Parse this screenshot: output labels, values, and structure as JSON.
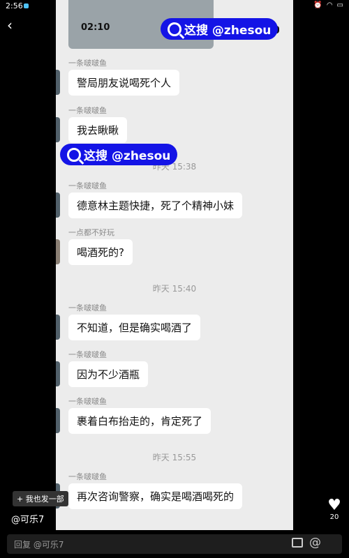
{
  "status": {
    "time": "2:56",
    "battery": "36",
    "screenshot_time": "02:10"
  },
  "watermark": {
    "text": "这搜 @zhesou"
  },
  "messages": [
    {
      "sender": "一条啵啵鱼",
      "text": "警局朋友说喝死个人"
    },
    {
      "sender": "一条啵啵鱼",
      "text": "我去瞅瞅"
    },
    {
      "sender": "一条啵啵鱼",
      "text": "德意林主题快捷，死了个精神小妹"
    },
    {
      "sender": "一点都不好玩",
      "text": "喝酒死的?"
    },
    {
      "sender": "一条啵啵鱼",
      "text": "不知道，但是确实喝酒了"
    },
    {
      "sender": "一条啵啵鱼",
      "text": "因为不少酒瓶"
    },
    {
      "sender": "一条啵啵鱼",
      "text": "裹着白布抬走的，肯定死了"
    },
    {
      "sender": "一条啵啵鱼",
      "text": "再次咨询警察，确实是喝酒喝死的"
    }
  ],
  "timestamps": [
    "昨天 15:38",
    "昨天 15:40",
    "昨天 15:55"
  ],
  "footer": {
    "side_tag": "+ 我也发一部",
    "author": "@可乐7",
    "like_count": "20",
    "reply_placeholder": "回复 @可乐7"
  },
  "icons": {
    "back": "chevron-left-icon",
    "like": "heart-icon",
    "image": "image-icon",
    "at": "at-icon"
  }
}
